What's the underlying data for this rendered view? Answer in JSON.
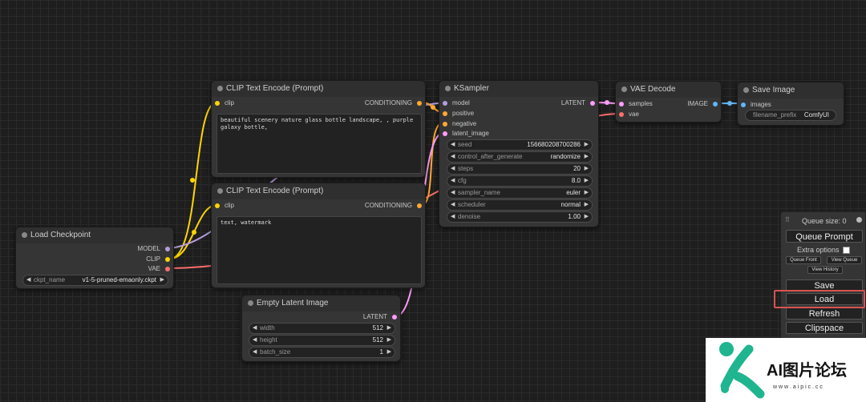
{
  "colors": {
    "model": "#b39ddb",
    "clip": "#ffd500",
    "vae": "#ff6e6e",
    "conditioning": "#ffa931",
    "latent": "#ff9cf9",
    "image": "#64b5f6",
    "highlight": "#d9534f"
  },
  "load_checkpoint": {
    "title": "Load Checkpoint",
    "outputs": {
      "model": "MODEL",
      "clip": "CLIP",
      "vae": "VAE"
    },
    "ckpt_name": {
      "label": "ckpt_name",
      "value": "v1-5-pruned-emaonly.ckpt"
    }
  },
  "clip_positive": {
    "title": "CLIP Text Encode (Prompt)",
    "input": "clip",
    "output": "CONDITIONING",
    "text": "beautiful scenery nature glass bottle landscape, , purple galaxy bottle,"
  },
  "clip_negative": {
    "title": "CLIP Text Encode (Prompt)",
    "input": "clip",
    "output": "CONDITIONING",
    "text": "text, watermark"
  },
  "empty_latent": {
    "title": "Empty Latent Image",
    "output": "LATENT",
    "widgets": [
      {
        "label": "width",
        "value": "512"
      },
      {
        "label": "height",
        "value": "512"
      },
      {
        "label": "batch_size",
        "value": "1"
      }
    ]
  },
  "ksampler": {
    "title": "KSampler",
    "inputs": {
      "model": "model",
      "positive": "positive",
      "negative": "negative",
      "latent_image": "latent_image"
    },
    "output": "LATENT",
    "widgets": [
      {
        "label": "seed",
        "value": "156680208700286"
      },
      {
        "label": "control_after_generate",
        "value": "randomize"
      },
      {
        "label": "steps",
        "value": "20"
      },
      {
        "label": "cfg",
        "value": "8.0"
      },
      {
        "label": "sampler_name",
        "value": "euler"
      },
      {
        "label": "scheduler",
        "value": "normal"
      },
      {
        "label": "denoise",
        "value": "1.00"
      }
    ]
  },
  "vae_decode": {
    "title": "VAE Decode",
    "inputs": {
      "samples": "samples",
      "vae": "vae"
    },
    "output": "IMAGE"
  },
  "save_image": {
    "title": "Save Image",
    "input": "images",
    "filename_prefix": {
      "label": "filename_prefix",
      "value": "ComfyUI"
    }
  },
  "menu": {
    "queue_size": "Queue size: 0",
    "queue_prompt": "Queue Prompt",
    "extra_options": "Extra options",
    "queue_front": "Queue Front",
    "view_queue": "View Queue",
    "view_history": "View History",
    "save": "Save",
    "load": "Load",
    "refresh": "Refresh",
    "clipspace": "Clipspace"
  },
  "watermark": {
    "brand": "AI图片论坛",
    "url": "w w w . a i p i c . c c"
  }
}
